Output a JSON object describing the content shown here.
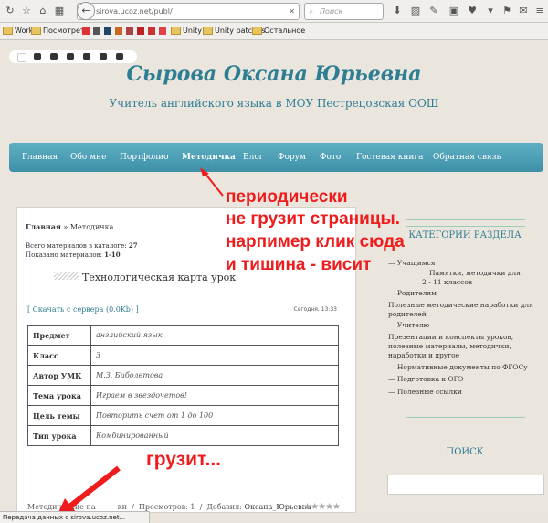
{
  "browser": {
    "url": "sirova.ucoz.net/publ/",
    "search_placeholder": "Поиск",
    "bookmarks": [
      "Work",
      "Посмотреть",
      "Unity",
      "Unity patches",
      "Остальное"
    ]
  },
  "site": {
    "title": "Сырова Оксана Юрьевна",
    "subtitle": "Учитель английского языка в МОУ Пестрецовская ООШ",
    "nav": [
      "Главная",
      "Обо мне",
      "Портфолио",
      "Методичка",
      "Блог",
      "Форум",
      "Фото",
      "Гостевая книга",
      "Обратная связь"
    ]
  },
  "content": {
    "breadcrumb_home": "Главная",
    "breadcrumb_sep": "»",
    "breadcrumb_current": "Методичка",
    "total_label": "Всего материалов в каталоге:",
    "total_value": "27",
    "shown_label": "Показано материалов:",
    "shown_value": "1-10",
    "article_title": "Технологическая карта урок",
    "download": "[ Скачать с сервера (0.0Kb) ]",
    "date": "Сегодня, 13:33",
    "table": [
      {
        "k": "Предмет",
        "v": "английский язык"
      },
      {
        "k": "Класс",
        "v": "3"
      },
      {
        "k": "Автор УМК",
        "v": "М.З. Биболетова"
      },
      {
        "k": "Тема урока",
        "v": "Играем в звездочетов!"
      },
      {
        "k": "Цель темы",
        "v": "Повторить счет от 1 до 100"
      },
      {
        "k": "Тип урока",
        "v": "Комбинированный"
      }
    ],
    "footer_category": "Методические на",
    "footer_category_end": "ки",
    "footer_views": "Просмотров: 1",
    "footer_added_label": "Добавил:",
    "footer_added_by": "Оксана_Юрьевна"
  },
  "sidebar": {
    "categories_heading": "КАТЕГОРИИ РАЗДЕЛА",
    "items": [
      "— Учащимся",
      "Памятки, методички для",
      "2 - 11 классов",
      "— Родителям",
      "Полезные методические наработки для",
      "родителей",
      "— Учителю",
      "Презентации и конспекты уроков,",
      "полезные материалы, методички,",
      "наработки и другое",
      "— Нормативные документы по ФГОСу",
      "— Подготовка к ОГЭ",
      "— Полезные ссылки"
    ],
    "search_heading": "ПОИСК"
  },
  "annotations": {
    "line1": "периодически",
    "line2": "не грузит страницы.",
    "line3": "нарпимер клик сюда",
    "line4": "и тишина - висит",
    "loading": "грузит...",
    "color": "#ee1c1c"
  },
  "status_bar": "Передача данных с sirova.ucoz.net..."
}
